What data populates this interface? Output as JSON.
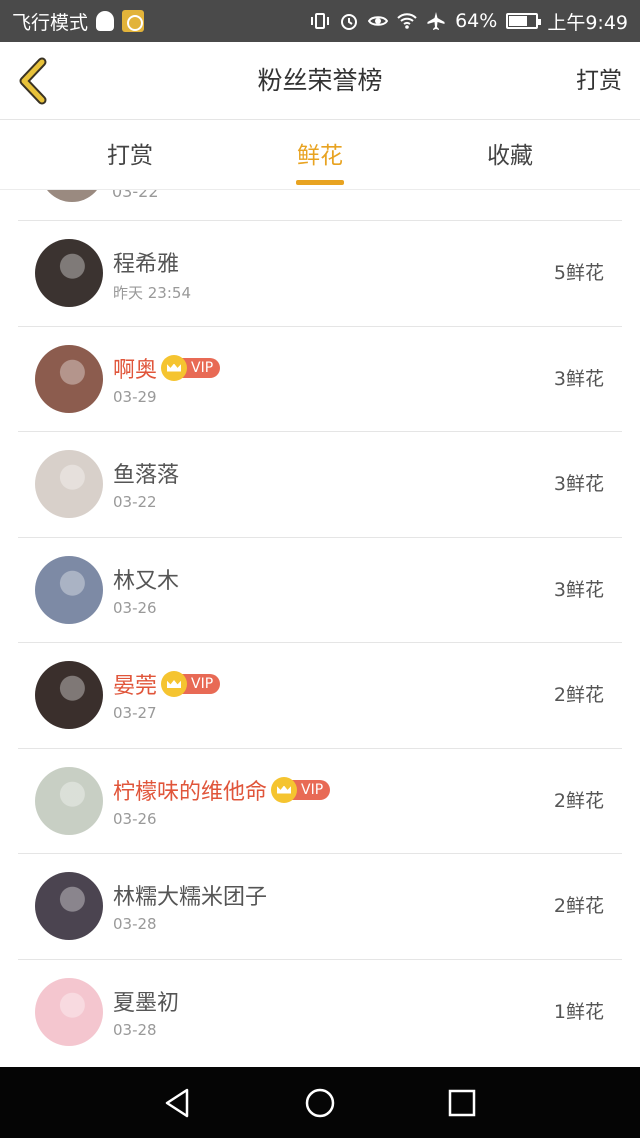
{
  "status_bar": {
    "left_text": "飞行模式",
    "battery": "64%",
    "time": "上午9:49",
    "battery_level": 0.64
  },
  "nav": {
    "title": "粉丝荣誉榜",
    "action": "打赏"
  },
  "tabs": [
    {
      "label": "打赏",
      "active": false
    },
    {
      "label": "鲜花",
      "active": true
    },
    {
      "label": "收藏",
      "active": false
    }
  ],
  "partial_row": {
    "date": "03-22"
  },
  "rows": [
    {
      "name": "程希雅",
      "vip": false,
      "date": "昨天  23:54",
      "count": "5鲜花",
      "avatar_color": "#3b3330"
    },
    {
      "name": "啊奥",
      "vip": true,
      "vip_label": "VIP",
      "date": "03-29",
      "count": "3鲜花",
      "avatar_color": "#8c5c4e"
    },
    {
      "name": "鱼落落",
      "vip": false,
      "date": "03-22",
      "count": "3鲜花",
      "avatar_color": "#d8d0ca"
    },
    {
      "name": "林又木",
      "vip": false,
      "date": "03-26",
      "count": "3鲜花",
      "avatar_color": "#7d8aa5"
    },
    {
      "name": "晏莞",
      "vip": true,
      "vip_label": "VIP",
      "date": "03-27",
      "count": "2鲜花",
      "avatar_color": "#3a2f2c"
    },
    {
      "name": "柠檬味的维他命",
      "vip": true,
      "vip_label": "VIP",
      "date": "03-26",
      "count": "2鲜花",
      "avatar_color": "#c8cfc4"
    },
    {
      "name": "林糯大糯米团子",
      "vip": false,
      "date": "03-28",
      "count": "2鲜花",
      "avatar_color": "#4b4450"
    },
    {
      "name": "夏墨初",
      "vip": false,
      "date": "03-28",
      "count": "1鲜花",
      "avatar_color": "#f4c6cf"
    }
  ],
  "colors": {
    "accent": "#e8a321",
    "vip_name": "#e0553a",
    "status_bar": "#4a4a4a"
  }
}
